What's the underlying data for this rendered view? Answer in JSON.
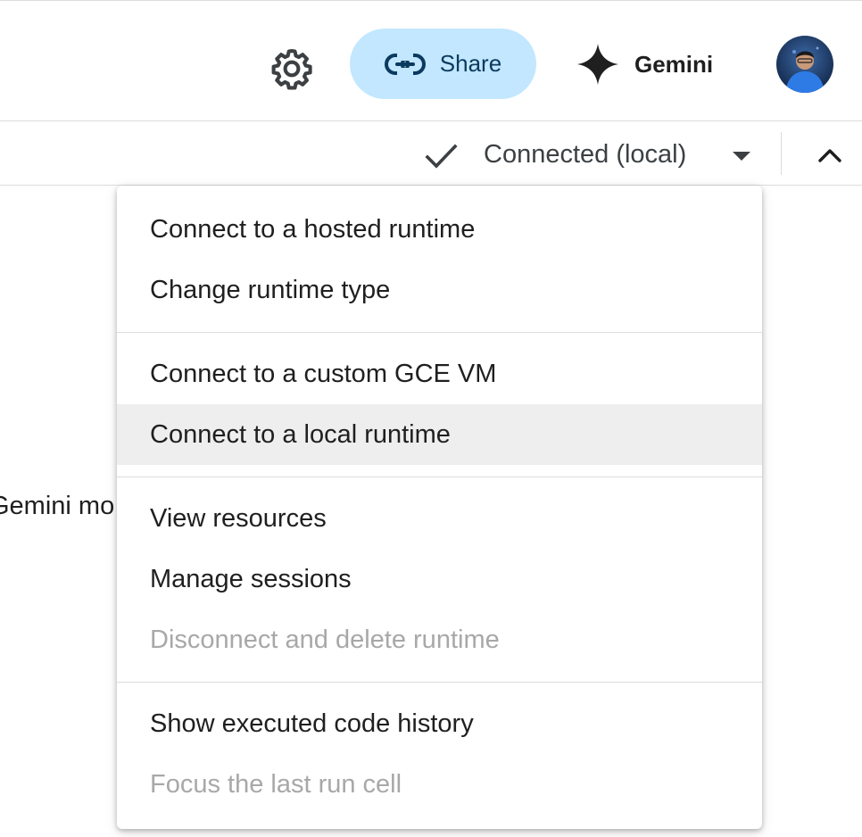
{
  "header": {
    "share_label": "Share",
    "gemini_label": "Gemini",
    "icons": {
      "settings": "gear-icon",
      "share": "link-icon",
      "gemini": "sparkle-icon",
      "avatar": "avatar"
    },
    "colors": {
      "share_bg": "#c2e7ff",
      "share_text": "#0b3a5e"
    }
  },
  "runtime_bar": {
    "status": "Connected (local)"
  },
  "background": {
    "partial_text": "Gemini mo"
  },
  "menu": {
    "items": [
      {
        "label": "Connect to a hosted runtime"
      },
      {
        "label": "Change runtime type"
      },
      {
        "label": "Connect to a custom GCE VM"
      },
      {
        "label": "Connect to a local runtime"
      },
      {
        "label": "View resources"
      },
      {
        "label": "Manage sessions"
      },
      {
        "label": "Disconnect and delete runtime"
      },
      {
        "label": "Show executed code history"
      },
      {
        "label": "Focus the last run cell"
      }
    ]
  }
}
